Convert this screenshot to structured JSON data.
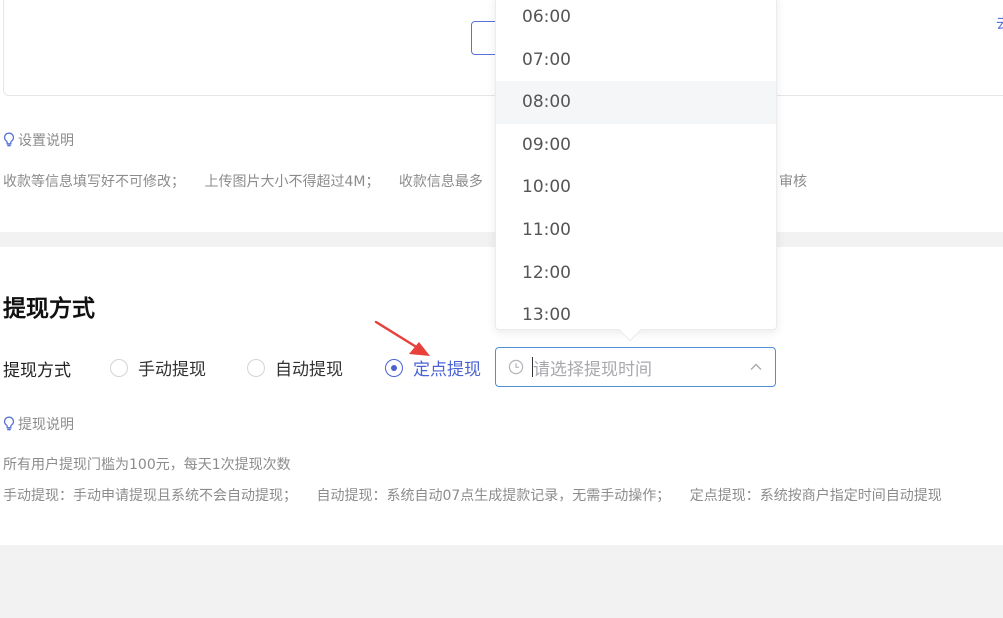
{
  "top_section": {
    "edge_text": "去",
    "note_heading": "设置说明",
    "notes": [
      "收款等信息填写好不可修改；",
      "上传图片大小不得超过4M；",
      "收款信息最多"
    ],
    "notes_tail": "审核"
  },
  "withdraw": {
    "title": "提现方式",
    "label": "提现方式",
    "options": [
      {
        "label": "手动提现",
        "checked": false
      },
      {
        "label": "自动提现",
        "checked": false
      },
      {
        "label": "定点提现",
        "checked": true
      }
    ],
    "time_placeholder": "请选择提现时间",
    "note_heading": "提现说明",
    "threshold_note": "所有用户提现门槛为100元，每天1次提现次数",
    "mode_notes": [
      "手动提现：手动申请提现且系统不会自动提现；",
      "自动提现：系统自动07点生成提款记录，无需手动操作；",
      "定点提现：系统按商户指定时间自动提现"
    ]
  },
  "time_dropdown": {
    "items": [
      "06:00",
      "07:00",
      "08:00",
      "09:00",
      "10:00",
      "11:00",
      "12:00",
      "13:00"
    ],
    "hovered": "08:00"
  },
  "colors": {
    "accent": "#4a63d3",
    "input_focus_border": "#4f8fd6",
    "annotation_arrow": "#e8403a",
    "muted_text": "#8c8c8c"
  },
  "icons": [
    "bulb-icon",
    "clock-icon",
    "chevron-up-icon",
    "annotation-arrow"
  ]
}
